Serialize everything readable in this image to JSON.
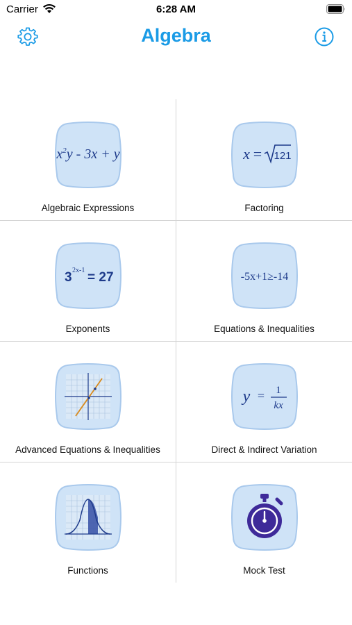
{
  "status_bar": {
    "carrier": "Carrier",
    "time": "6:28 AM"
  },
  "nav": {
    "title": "Algebra"
  },
  "tiles": [
    {
      "label": "Algebraic Expressions"
    },
    {
      "label": "Factoring",
      "expr_lhs": "x",
      "expr_eq": "=",
      "radicand": "121"
    },
    {
      "label": "Exponents",
      "base": "3",
      "exponent": "2x-1",
      "rhs": "= 27"
    },
    {
      "label": "Equations & Inequalities",
      "expr": "-5x+1≥-14"
    },
    {
      "label": "Advanced Equations & Inequalities"
    },
    {
      "label": "Direct & Indirect Variation",
      "lhs": "y",
      "eq": "=",
      "numerator": "1",
      "denominator": "kx"
    },
    {
      "label": "Functions"
    },
    {
      "label": "Mock Test"
    }
  ],
  "colors": {
    "accent": "#1a9be6",
    "tile_fill": "#cfe3f7",
    "tile_border": "#a9c9ec",
    "math_ink": "#1d3a8a"
  }
}
